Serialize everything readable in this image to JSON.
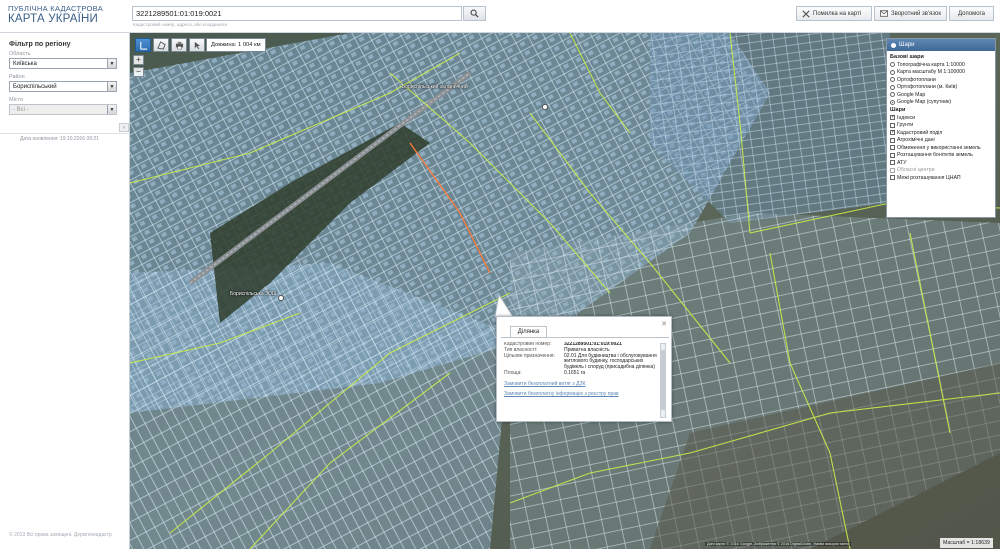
{
  "header": {
    "logo_line1": "ПУБЛІЧНА КАДАСТРОВА",
    "logo_line2": "КАРТА УКРАЇНИ",
    "search_value": "3221289501:01:019:0021",
    "search_hint": "Кадастровий номер, адреса, або координати",
    "buttons": {
      "error": "Помилка на карті",
      "feedback": "Зворотний зв'язок",
      "help": "Допомога"
    }
  },
  "sidebar": {
    "title": "Фільтр по регіону",
    "region_label": "Область",
    "region_value": "Київська",
    "district_label": "Район",
    "district_value": "Бориспільський",
    "city_label": "Місто",
    "city_value": "- Всі -",
    "data_date": "Дата оновлення: 19.10.2016 09:21",
    "copyright": "© 2013 Всі права захищені. Держгеокадастр"
  },
  "map": {
    "measure": "Довжина: 1 004 км",
    "scale": "Масштаб = 1:18639",
    "attribution": "Дані карти © 2016 Google, Зображення © 2016 DigitalGlobe, Умови використання",
    "labels": [
      "Бориспільський залізничний",
      "Бориспільська ЗОШ"
    ],
    "colors": {
      "parcel_fill": "#7fa7c9",
      "parcel_stroke": "#cfe1f0",
      "boundary": "#c9ee4a",
      "selected": "#ff7a3a"
    }
  },
  "layers": {
    "title": "Шари",
    "base_title": "Базові шари",
    "base": [
      {
        "label": "Топографічна карта 1:10000",
        "on": false
      },
      {
        "label": "Карта масштабу М 1:100000",
        "on": false
      },
      {
        "label": "Ортофотоплани",
        "on": false
      },
      {
        "label": "Ортофотоплани (м. Київ)",
        "on": false
      },
      {
        "label": "Google Map",
        "on": false
      },
      {
        "label": "Google Map (супутник)",
        "on": true
      }
    ],
    "overlay_title": "Шари",
    "overlays": [
      {
        "label": "Індекси",
        "checked": true,
        "dim": false
      },
      {
        "label": "Ґрунти",
        "checked": false,
        "dim": false
      },
      {
        "label": "Кадастровий поділ",
        "checked": true,
        "dim": false
      },
      {
        "label": "Агрохімічні дані",
        "checked": false,
        "dim": false
      },
      {
        "label": "Обмеження у використанні земель",
        "checked": false,
        "dim": false
      },
      {
        "label": "Розташування бонітетів земель",
        "checked": false,
        "dim": false
      },
      {
        "label": "АТУ",
        "checked": false,
        "dim": false
      },
      {
        "label": "Обласні центри",
        "checked": false,
        "dim": true
      },
      {
        "label": "Межі розташування ЦНАП",
        "checked": false,
        "dim": false
      }
    ]
  },
  "popup": {
    "tab": "Ділянка",
    "rows": [
      {
        "k": "Кадастровий номер:",
        "v": "3221289501:01:019:0021",
        "strong": true
      },
      {
        "k": "Тип власності:",
        "v": "Приватна власність",
        "strong": false
      },
      {
        "k": "Цільове призначення:",
        "v": "02.01 Для будівництва і обслуговування житлового будинку, господарських будівель і споруд (присадибна ділянка)",
        "strong": false
      },
      {
        "k": "Площа:",
        "v": "0.1651 га",
        "strong": false
      }
    ],
    "link1": "Замовити безоплатний витяг з ДЗК",
    "link2": "Замовити безоплатну інформацію з реєстру прав"
  }
}
